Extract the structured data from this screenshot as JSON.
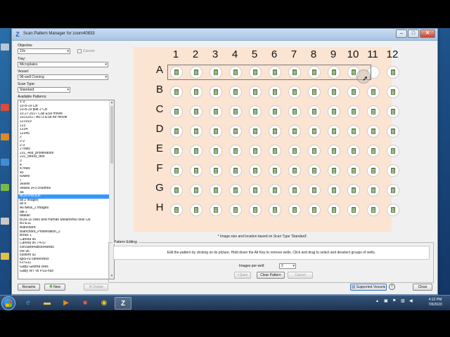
{
  "window": {
    "title": "Scan Pattern Manager for zoom40833",
    "app_icon": "Z"
  },
  "controls": {
    "objective_label": "Objective",
    "objective_value": "10x",
    "current_label": "Current",
    "tray_label": "Tray:",
    "tray_value": "Microplates",
    "vessel_label": "Vessel:",
    "vessel_value": "96-well Corning",
    "scan_type_label": "Scan Type:",
    "scan_type_value": "Standard",
    "patterns_label": "Available Patterns:"
  },
  "patterns": [
    "1-3",
    "10-8-19 CB",
    "10-8-19 plat 2 CB",
    "10.27.2017 Cas ES8 movie",
    "11012017 A673 ES8 for movie",
    "121919",
    "123",
    "1234",
    "12345",
    "2",
    "2-2",
    "2-3",
    "2 rows",
    "231_468_proliferation",
    "231_stress_test",
    "3",
    "4",
    "4 rows",
    "45",
    "60well",
    "7",
    "96MW",
    "96well 3+3 columns",
    "aa",
    "ACR-PROLIF",
    "all 2 images",
    "all 4",
    "All wells_2 images",
    "alk-1",
    "atakan",
    "B16F10 cells and Human Melanoma cells CB",
    "B2:E11",
    "Blanchard",
    "Blanchard_Proliferation_2",
    "Brock 1",
    "Caresa 96",
    "Caresa 96 T47D",
    "con3and4abcks4and5",
    "cre 96",
    "custom 92",
    "fgs5-r9 cdmerefect",
    "F2:G11",
    "Gaby Glioma cells",
    "Gaby WT vs PS3-null"
  ],
  "selected_pattern_index": 24,
  "buttons": {
    "rename": "Rename",
    "new": "New",
    "delete": "Delete",
    "save": "Save",
    "clear_pattern": "Clear Pattern",
    "cancel": "Cancel",
    "supported_vessels": "Supported Vessels",
    "close": "Close"
  },
  "plate": {
    "columns": [
      "1",
      "2",
      "3",
      "4",
      "5",
      "6",
      "7",
      "8",
      "9",
      "10",
      "11",
      "12"
    ],
    "rows": [
      "A",
      "B",
      "C",
      "D",
      "E",
      "F",
      "G",
      "H"
    ],
    "note": "* Image size and location based on Scan Type 'Standard'."
  },
  "editing": {
    "legend": "Pattern Editing",
    "instructions": "Edit the pattern by clicking on its picture. Hold down the Alt Key to remove wells. Click and drag to select and deselect groups of wells.",
    "images_per_well_label": "Images per well:",
    "images_per_well_value": "2"
  },
  "taskbar": {
    "time": "4:12 PM",
    "date": "7/8/2020"
  },
  "colors": {
    "plate_bg": "#fce4d2",
    "selection": "#3399ff",
    "titlebar": "#b8d0ea"
  }
}
